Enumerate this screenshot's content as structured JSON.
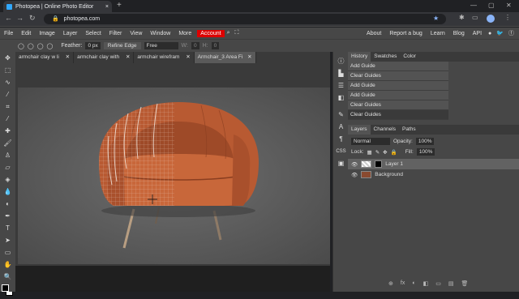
{
  "browser": {
    "tab_title": "Photopea | Online Photo Editor",
    "tab_close": "×",
    "new_tab": "+",
    "url": "photopea.com"
  },
  "menu": {
    "items": [
      "File",
      "Edit",
      "Image",
      "Layer",
      "Select",
      "Filter",
      "View",
      "Window",
      "More"
    ],
    "account": "Account",
    "right_links": [
      "About",
      "Report a bug",
      "Learn",
      "Blog",
      "API"
    ]
  },
  "options": {
    "feather_label": "Feather:",
    "feather_value": "0 px",
    "refine_edge": "Refine Edge",
    "style_value": "Free",
    "w_label": "W:",
    "w_value": "0",
    "h_label": "H:",
    "h_value": "0"
  },
  "doc_tabs": [
    {
      "label": "armchair clay w li"
    },
    {
      "label": "armchair clay with"
    },
    {
      "label": "armchair wirefram"
    },
    {
      "label": "Armchair_3 Area Fi"
    }
  ],
  "history": {
    "tabs": [
      "History",
      "Swatches",
      "Color"
    ],
    "items": [
      "Add Guide",
      "Clear Guides",
      "Add Guide",
      "Add Guide",
      "Clear Guides",
      "Clear Guides"
    ]
  },
  "layers": {
    "tabs": [
      "Layers",
      "Channels",
      "Paths"
    ],
    "blend_mode": "Normal",
    "opacity_label": "Opacity:",
    "opacity_value": "100%",
    "lock_label": "Lock:",
    "fill_label": "Fill:",
    "fill_value": "100%",
    "items": [
      "Layer 1",
      "Background"
    ]
  },
  "colors": {
    "accent": "#d00000",
    "panel": "#474747",
    "chair": "#b85a32"
  }
}
